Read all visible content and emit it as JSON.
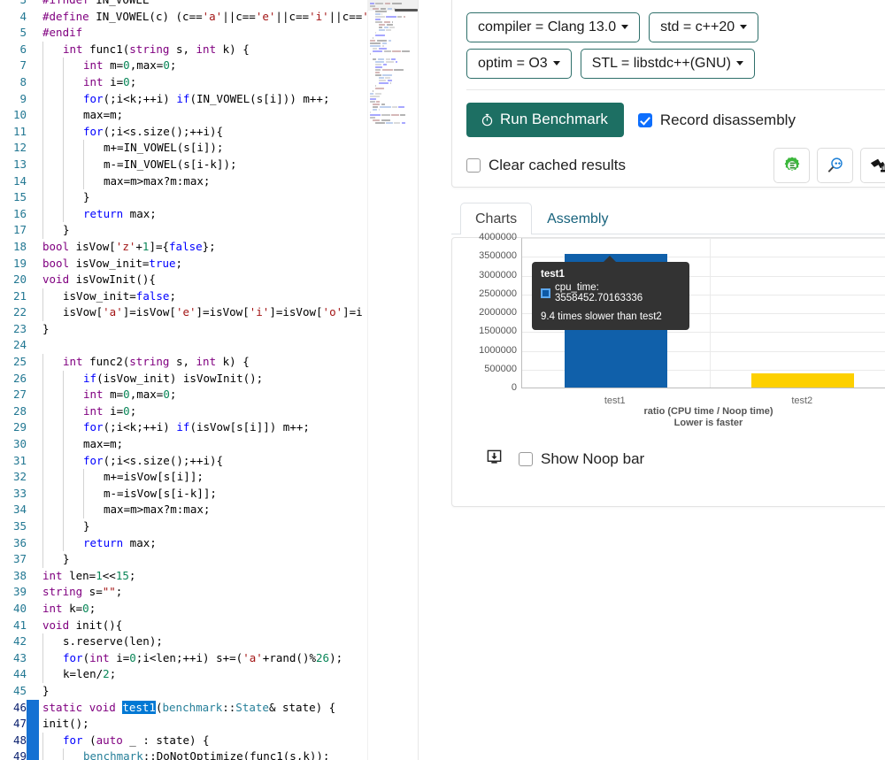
{
  "editor": {
    "name": "monaco-code-editor",
    "language": "cpp",
    "selection_lines": [
      46,
      47,
      48,
      49
    ],
    "highlighted_token": "test1",
    "lines": [
      {
        "n": "4",
        "indent": 0,
        "text": "#define IN_VOWEL(c) (c=='a'||c=='e'||c=='i'||c=='"
      },
      {
        "n": "5",
        "indent": 0,
        "text": "#endif"
      },
      {
        "n": "6",
        "indent": 1,
        "text": "int func1(string s, int k) {"
      },
      {
        "n": "7",
        "indent": 2,
        "text": "int m=0,max=0;"
      },
      {
        "n": "8",
        "indent": 2,
        "text": "int i=0;"
      },
      {
        "n": "9",
        "indent": 2,
        "text": "for(;i<k;++i) if(IN_VOWEL(s[i])) m++;"
      },
      {
        "n": "10",
        "indent": 2,
        "text": "max=m;"
      },
      {
        "n": "11",
        "indent": 2,
        "text": "for(;i<s.size();++i){"
      },
      {
        "n": "12",
        "indent": 3,
        "text": "m+=IN_VOWEL(s[i]);"
      },
      {
        "n": "13",
        "indent": 3,
        "text": "m-=IN_VOWEL(s[i-k]);"
      },
      {
        "n": "14",
        "indent": 3,
        "text": "max=m>max?m:max;"
      },
      {
        "n": "15",
        "indent": 2,
        "text": "}"
      },
      {
        "n": "16",
        "indent": 2,
        "text": "return max;"
      },
      {
        "n": "17",
        "indent": 1,
        "text": "}"
      },
      {
        "n": "18",
        "indent": 0,
        "text": "bool isVow['z'+1]={false};"
      },
      {
        "n": "19",
        "indent": 0,
        "text": "bool isVow_init=true;"
      },
      {
        "n": "20",
        "indent": 0,
        "text": "void isVowInit(){"
      },
      {
        "n": "21",
        "indent": 1,
        "text": "isVow_init=false;"
      },
      {
        "n": "22",
        "indent": 1,
        "text": "isVow['a']=isVow['e']=isVow['i']=isVow['o']=i"
      },
      {
        "n": "23",
        "indent": 0,
        "text": "}"
      },
      {
        "n": "24",
        "indent": 0,
        "text": ""
      },
      {
        "n": "25",
        "indent": 1,
        "text": "int func2(string s, int k) {"
      },
      {
        "n": "26",
        "indent": 2,
        "text": "if(isVow_init) isVowInit();"
      },
      {
        "n": "27",
        "indent": 2,
        "text": "int m=0,max=0;"
      },
      {
        "n": "28",
        "indent": 2,
        "text": "int i=0;"
      },
      {
        "n": "29",
        "indent": 2,
        "text": "for(;i<k;++i) if(isVow[s[i]]) m++;"
      },
      {
        "n": "30",
        "indent": 2,
        "text": "max=m;"
      },
      {
        "n": "31",
        "indent": 2,
        "text": "for(;i<s.size();++i){"
      },
      {
        "n": "32",
        "indent": 3,
        "text": "m+=isVow[s[i]];"
      },
      {
        "n": "33",
        "indent": 3,
        "text": "m-=isVow[s[i-k]];"
      },
      {
        "n": "34",
        "indent": 3,
        "text": "max=m>max?m:max;"
      },
      {
        "n": "35",
        "indent": 2,
        "text": "}"
      },
      {
        "n": "36",
        "indent": 2,
        "text": "return max;"
      },
      {
        "n": "37",
        "indent": 1,
        "text": "}"
      },
      {
        "n": "38",
        "indent": 0,
        "text": "int len=1<<15;"
      },
      {
        "n": "39",
        "indent": 0,
        "text": "string s=\"\";"
      },
      {
        "n": "40",
        "indent": 0,
        "text": "int k=0;"
      },
      {
        "n": "41",
        "indent": 0,
        "text": "void init(){"
      },
      {
        "n": "42",
        "indent": 1,
        "text": "s.reserve(len);"
      },
      {
        "n": "43",
        "indent": 1,
        "text": "for(int i=0;i<len;++i) s+=('a'+rand()%26);"
      },
      {
        "n": "44",
        "indent": 1,
        "text": "k=len/2;"
      },
      {
        "n": "45",
        "indent": 0,
        "text": "}"
      },
      {
        "n": "46",
        "indent": 0,
        "text": "static void test1(benchmark::State& state) {"
      },
      {
        "n": "47",
        "indent": 0,
        "text": "init();"
      },
      {
        "n": "48",
        "indent": 1,
        "text": "for (auto _ : state) {"
      },
      {
        "n": "49",
        "indent": 2,
        "text": "benchmark::DoNotOptimize(func1(s,k));"
      }
    ]
  },
  "options": {
    "compiler": {
      "label": "compiler = Clang 13.0",
      "name": "compiler",
      "value": "Clang 13.0"
    },
    "std": {
      "label": "std = c++20",
      "name": "std",
      "value": "c++20"
    },
    "optim": {
      "label": "optim = O3",
      "name": "optim",
      "value": "O3"
    },
    "stl": {
      "label": "STL = libstdc++(GNU)",
      "name": "STL",
      "value": "libstdc++(GNU)"
    }
  },
  "actions": {
    "run_button": {
      "label": "Run Benchmark",
      "icon": "stopwatch-icon",
      "color": "#1d6f63"
    },
    "record_disassembly": {
      "label": "Record disassembly",
      "checked": true
    },
    "clear_cached_results": {
      "label": "Clear cached results",
      "checked": false
    },
    "icon_buttons": [
      {
        "name": "compiler-explorer-icon",
        "title": "Compiler Explorer"
      },
      {
        "name": "cpp-insights-icon",
        "title": "C++ Insights"
      },
      {
        "name": "build-bench-icon",
        "title": "Build Bench"
      }
    ]
  },
  "tabs": [
    {
      "label": "Charts",
      "active": true
    },
    {
      "label": "Assembly",
      "active": false
    }
  ],
  "chart_footer": {
    "save_icon": "save-image-icon",
    "show_noop": {
      "label": "Show Noop bar",
      "checked": false
    }
  },
  "tooltip": {
    "title": "test1",
    "series_label": "cpu_time: 3558452.70163336",
    "note": "9.4 times slower than test2",
    "swatch_fill": "#0d59a6",
    "swatch_stroke": "#5da8ef",
    "background": "#333333"
  },
  "chart_data": {
    "type": "bar",
    "title": "",
    "categories": [
      "test1",
      "test2"
    ],
    "series": [
      {
        "name": "cpu_time",
        "values": [
          3558452.70163336,
          378000
        ],
        "colors": [
          "#1060aa",
          "#fdd000"
        ]
      }
    ],
    "xlabel": "ratio (CPU time / Noop time)",
    "xlabel_sub": "Lower is faster",
    "ylabel": "",
    "ylim": [
      0,
      4000000
    ],
    "yticks": [
      "4000000",
      "3500000",
      "3000000",
      "2500000",
      "2000000",
      "1500000",
      "1000000",
      "500000",
      "0"
    ],
    "ytick_values": [
      4000000,
      3500000,
      3000000,
      2500000,
      2000000,
      1500000,
      1000000,
      500000,
      0
    ],
    "grid": true,
    "legend": "none"
  }
}
